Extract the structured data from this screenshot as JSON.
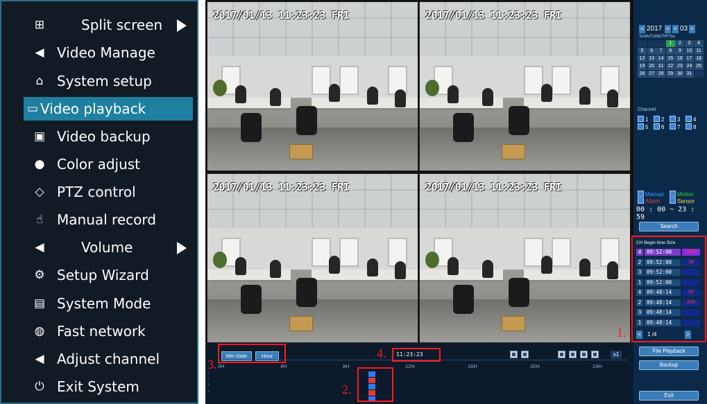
{
  "menu": {
    "items": [
      {
        "label": "Split screen",
        "icon": "grid-icon",
        "glyph": "⊞",
        "submenu": true
      },
      {
        "label": "Video Manage",
        "icon": "camera-icon",
        "glyph": "◀",
        "submenu": false
      },
      {
        "label": "System setup",
        "icon": "home-icon",
        "glyph": "⌂",
        "submenu": false
      },
      {
        "label": "Video playback",
        "icon": "film-icon",
        "glyph": "▭",
        "submenu": false,
        "active": true
      },
      {
        "label": "Video backup",
        "icon": "floppy-disk-icon",
        "glyph": "▣",
        "submenu": false
      },
      {
        "label": "Color adjust",
        "icon": "palette-icon",
        "glyph": "●",
        "submenu": false
      },
      {
        "label": "PTZ control",
        "icon": "ptz-diamond-icon",
        "glyph": "◇",
        "submenu": false
      },
      {
        "label": "Manual record",
        "icon": "hand-pointer-icon",
        "glyph": "☝",
        "submenu": false
      },
      {
        "label": "Volume",
        "icon": "speaker-icon",
        "glyph": "◀",
        "submenu": true
      },
      {
        "label": "Setup Wizard",
        "icon": "gears-icon",
        "glyph": "⚙",
        "submenu": false
      },
      {
        "label": "System Mode",
        "icon": "document-gear-icon",
        "glyph": "▤",
        "submenu": false
      },
      {
        "label": "Fast network",
        "icon": "globe-network-icon",
        "glyph": "◍",
        "submenu": false
      },
      {
        "label": "Adjust channel",
        "icon": "camera-icon",
        "glyph": "◀",
        "submenu": false
      },
      {
        "label": "Exit System",
        "icon": "power-icon",
        "glyph": "⏻",
        "submenu": false
      }
    ],
    "colors": {
      "background": "#121a24",
      "active": "#1f7fa0",
      "border": "#2a6f8f"
    }
  },
  "cameras": [
    {
      "osd": "2017/01/13 11:23:23 FRI"
    },
    {
      "osd": "2017/01/13 11:23:23 FRI"
    },
    {
      "osd": "2017/01/13 11:23:23 FRI"
    },
    {
      "osd": "2017/01/13 11:23:23 FRI"
    }
  ],
  "calendar": {
    "year": "2017",
    "month": "03",
    "weekdays": "SuMoTuWeThFrSa",
    "rows": [
      [
        "",
        "",
        "",
        "1",
        "2",
        "3",
        "4"
      ],
      [
        "5",
        "6",
        "7",
        "8",
        "9",
        "10",
        "11"
      ],
      [
        "12",
        "13",
        "14",
        "15",
        "16",
        "17",
        "18"
      ],
      [
        "19",
        "20",
        "21",
        "22",
        "23",
        "24",
        "25"
      ],
      [
        "26",
        "27",
        "28",
        "29",
        "30",
        "31",
        ""
      ]
    ],
    "selected_day": "1"
  },
  "channels": {
    "label": "Channel",
    "items": [
      "1",
      "2",
      "3",
      "4",
      "5",
      "6",
      "7",
      "8"
    ]
  },
  "record_types": [
    {
      "label": "Manual",
      "color": "#3aa0ff"
    },
    {
      "label": "Motion",
      "color": "#39d239"
    },
    {
      "label": "Alarm",
      "color": "#ff3c3c"
    },
    {
      "label": "Sensor",
      "color": "#f0e040"
    }
  ],
  "search": {
    "time_range": "00 : 00  ~  23 : 59",
    "button": "Search"
  },
  "results": {
    "headers": "CH  Begin time    Size",
    "rows": [
      {
        "ch": "4",
        "time": "09:52:00",
        "size": "39M",
        "selected": true
      },
      {
        "ch": "2",
        "time": "09:52:00",
        "size": "38"
      },
      {
        "ch": "3",
        "time": "09:52:00",
        "size": ""
      },
      {
        "ch": "1",
        "time": "09:52:00",
        "size": ""
      },
      {
        "ch": "4",
        "time": "09:48:14",
        "size": "40"
      },
      {
        "ch": "2",
        "time": "09:48:14",
        "size": "239"
      },
      {
        "ch": "3",
        "time": "09:48:14",
        "size": ""
      },
      {
        "ch": "1",
        "time": "09:48:14",
        "size": ""
      }
    ],
    "pager": "1   /4"
  },
  "right_buttons": {
    "file_playback": "File Playback",
    "backup": "Backup",
    "exit": "Exit"
  },
  "timeline": {
    "mode_buttons": [
      "Min Gate",
      "Hour"
    ],
    "current_time": "11:23:23",
    "speed": "x1",
    "ticks": [
      "0H",
      "4H",
      "8H",
      "12H",
      "16H",
      "20H",
      "24H"
    ],
    "channel_labels": [
      "1",
      "2",
      "3",
      "4"
    ]
  },
  "annotations": [
    "1.",
    "2.",
    "3.",
    "4."
  ]
}
